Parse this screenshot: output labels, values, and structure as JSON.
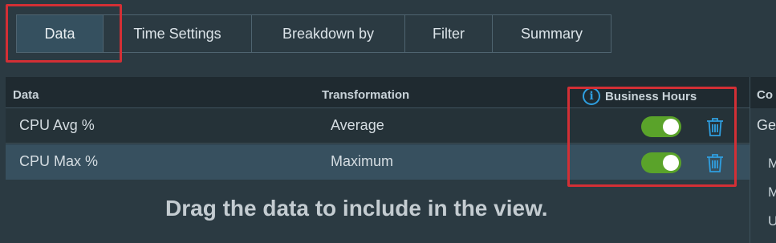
{
  "tabs": [
    {
      "label": "Data",
      "active": true
    },
    {
      "label": "Time Settings",
      "active": false
    },
    {
      "label": "Breakdown by",
      "active": false
    },
    {
      "label": "Filter",
      "active": false
    },
    {
      "label": "Summary",
      "active": false
    }
  ],
  "table": {
    "headers": {
      "data": "Data",
      "transformation": "Transformation",
      "business_hours": "Business Hours",
      "info_icon_glyph": "i"
    },
    "rows": [
      {
        "data": "CPU Avg %",
        "transformation": "Average",
        "business_hours_enabled": true
      },
      {
        "data": "CPU Max %",
        "transformation": "Maximum",
        "business_hours_enabled": true
      }
    ]
  },
  "right_panel": {
    "header": "Co",
    "first_value": "Ge",
    "items": [
      "M",
      "M",
      "U"
    ]
  },
  "drag_message": "Drag the data to include in the view.",
  "colors": {
    "background": "#2b3a42",
    "toggle_on": "#5aa32a",
    "accent": "#2f9fe0",
    "highlight": "#d32f35"
  }
}
